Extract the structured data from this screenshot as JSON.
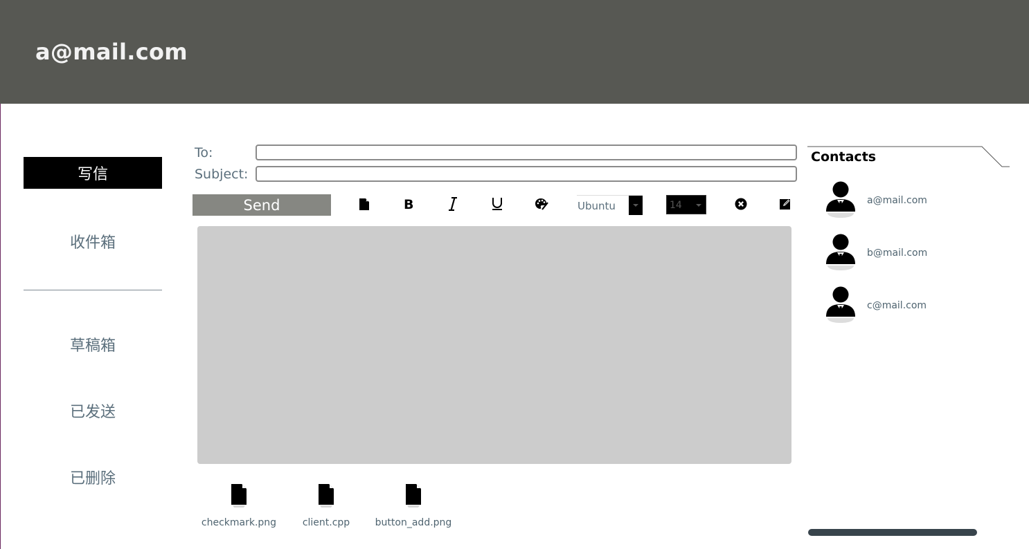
{
  "header": {
    "title": "a@mail.com"
  },
  "sidebar": {
    "compose_label": "写信",
    "items": [
      {
        "label": "收件箱"
      },
      {
        "label": "草稿箱"
      },
      {
        "label": "已发送"
      },
      {
        "label": "已删除"
      }
    ]
  },
  "compose": {
    "to_label": "To:",
    "to_value": "",
    "subject_label": "Subject:",
    "subject_value": "",
    "send_label": "Send",
    "font_family": "Ubuntu",
    "font_size": "14",
    "toolbar_icons": [
      "new-document-icon",
      "bold-icon",
      "italic-icon",
      "underline-icon",
      "palette-icon",
      "clear-format-icon",
      "edit-icon"
    ],
    "body_text": ""
  },
  "attachments": [
    {
      "name": "checkmark.png"
    },
    {
      "name": "client.cpp"
    },
    {
      "name": "button_add.png"
    }
  ],
  "contacts": {
    "title": "Contacts",
    "items": [
      {
        "email": "a@mail.com"
      },
      {
        "email": "b@mail.com"
      },
      {
        "email": "c@mail.com"
      }
    ]
  },
  "colors": {
    "header_bg": "#575853",
    "compose_bg": "#000000",
    "send_bg": "#868782",
    "editor_bg": "#cccccc",
    "nav_text": "#5b6f7c"
  }
}
